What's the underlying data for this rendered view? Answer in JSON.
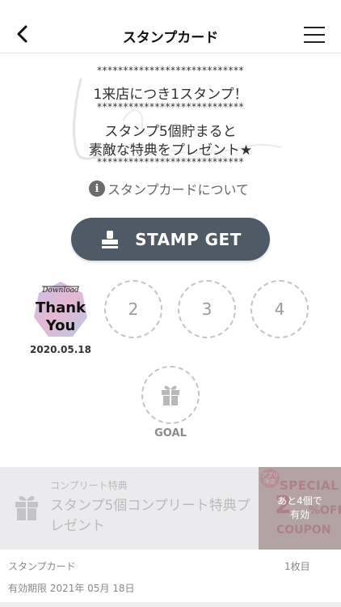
{
  "header": {
    "title": "スタンプカード"
  },
  "message": {
    "stars": "****************************",
    "line1": "1来店につき1スタンプ！",
    "line2": "スタンプ5個貯まると",
    "line3": "素敵な特典をプレゼント★"
  },
  "about": {
    "label": "スタンプカードについて"
  },
  "stamp_button": {
    "label": "STAMP GET"
  },
  "stamps": {
    "stamped": {
      "line1": "Download",
      "line2": "Thank",
      "line3": "You",
      "date": "2020.05.18"
    },
    "slots": [
      "2",
      "3",
      "4"
    ],
    "goal_label": "GOAL"
  },
  "complete": {
    "small": "コンプリート特典",
    "title": "スタンプ5個コンプリート特典プレゼント"
  },
  "coupon": {
    "tag": "アプリ限定",
    "line1": "SPECIAL",
    "line2": "2",
    "line3": "%OFF",
    "line4": "COUPON",
    "overlay_line1": "あと4個で",
    "overlay_line2": "有効"
  },
  "footer": {
    "card_label": "スタンプカード",
    "count": "1枚目",
    "expiry": "有効期限 2021年 05月 18日"
  },
  "colors": {
    "button_bg": "#4e5a66",
    "complete_bg": "#ebebee",
    "coupon_bg": "#e6c6c8"
  }
}
